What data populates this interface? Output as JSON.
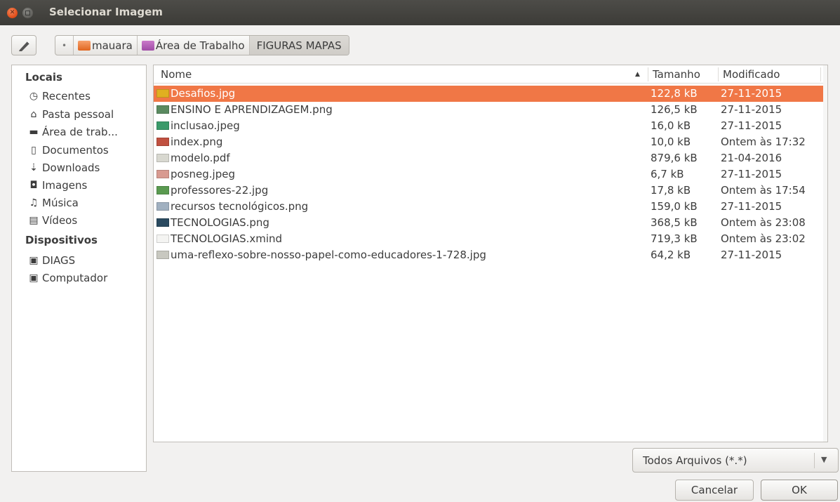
{
  "window": {
    "title": "Selecionar Imagem"
  },
  "breadcrumb": {
    "items": [
      "mauara",
      "Área de Trabalho",
      "FIGURAS MAPAS"
    ]
  },
  "sidebar": {
    "locais_heading": "Locais",
    "locais": [
      {
        "label": "Recentes",
        "icon": "clock-icon"
      },
      {
        "label": "Pasta pessoal",
        "icon": "home-icon"
      },
      {
        "label": "Área de trab...",
        "icon": "folder-icon"
      },
      {
        "label": "Documentos",
        "icon": "document-icon"
      },
      {
        "label": "Downloads",
        "icon": "download-icon"
      },
      {
        "label": "Imagens",
        "icon": "camera-icon"
      },
      {
        "label": "Música",
        "icon": "music-icon"
      },
      {
        "label": "Vídeos",
        "icon": "film-icon"
      }
    ],
    "devices_heading": "Dispositivos",
    "devices": [
      {
        "label": "DIAGS",
        "icon": "drive-icon"
      },
      {
        "label": "Computador",
        "icon": "drive-icon"
      }
    ]
  },
  "filelist": {
    "columns": {
      "name": "Nome",
      "size": "Tamanho",
      "modified": "Modificado"
    },
    "selected_index": 0,
    "files": [
      {
        "name": "Desafios.jpg",
        "size": "122,8 kB",
        "modified": "27-11-2015",
        "icon_color": "#e0b020"
      },
      {
        "name": "ENSINO E APRENDIZAGEM.png",
        "size": "126,5 kB",
        "modified": "27-11-2015",
        "icon_color": "#5a8a60"
      },
      {
        "name": "inclusao.jpeg",
        "size": "16,0 kB",
        "modified": "27-11-2015",
        "icon_color": "#3a9a6a"
      },
      {
        "name": "index.png",
        "size": "10,0 kB",
        "modified": "Ontem às 17:32",
        "icon_color": "#c05040"
      },
      {
        "name": "modelo.pdf",
        "size": "879,6 kB",
        "modified": "21-04-2016",
        "icon_color": "#d8d8d0"
      },
      {
        "name": "posneg.jpeg",
        "size": "6,7 kB",
        "modified": "27-11-2015",
        "icon_color": "#d89a90"
      },
      {
        "name": "professores-22.jpg",
        "size": "17,8 kB",
        "modified": "Ontem às 17:54",
        "icon_color": "#5a9a50"
      },
      {
        "name": "recursos tecnológicos.png",
        "size": "159,0 kB",
        "modified": "27-11-2015",
        "icon_color": "#a0b0c0"
      },
      {
        "name": "TECNOLOGIAS.png",
        "size": "368,5 kB",
        "modified": "Ontem às 23:08",
        "icon_color": "#2a4a60"
      },
      {
        "name": "TECNOLOGIAS.xmind",
        "size": "719,3 kB",
        "modified": "Ontem às 23:02",
        "icon_color": "#f4f4f2"
      },
      {
        "name": "uma-reflexo-sobre-nosso-papel-como-educadores-1-728.jpg",
        "size": "64,2 kB",
        "modified": "27-11-2015",
        "icon_color": "#c8c8c0"
      }
    ]
  },
  "filter": {
    "value": "Todos Arquivos (*.*)"
  },
  "buttons": {
    "cancel": "Cancelar",
    "ok": "OK"
  },
  "colors": {
    "selection": "#f07746",
    "titlebar": "#3c3b37"
  }
}
